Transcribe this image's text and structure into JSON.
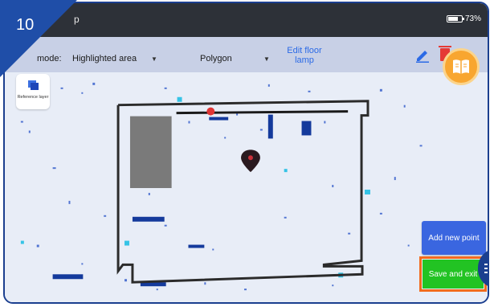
{
  "step_badge": "10",
  "statusbar": {
    "app_title": "p",
    "battery": "73%"
  },
  "toolbar": {
    "mode_label": "mode:",
    "mode_value": "Highlighted area",
    "shape_value": "Polygon",
    "edit_label": "Edit floor lamp"
  },
  "reference_layer": {
    "label": "Reference layer"
  },
  "actions": {
    "add_point": "Add new point",
    "save_exit": "Save and exit"
  },
  "colors": {
    "accent": "#2b6ae6",
    "save": "#22c323",
    "highlight": "#f26b1d",
    "badge": "#1f4ea8"
  }
}
